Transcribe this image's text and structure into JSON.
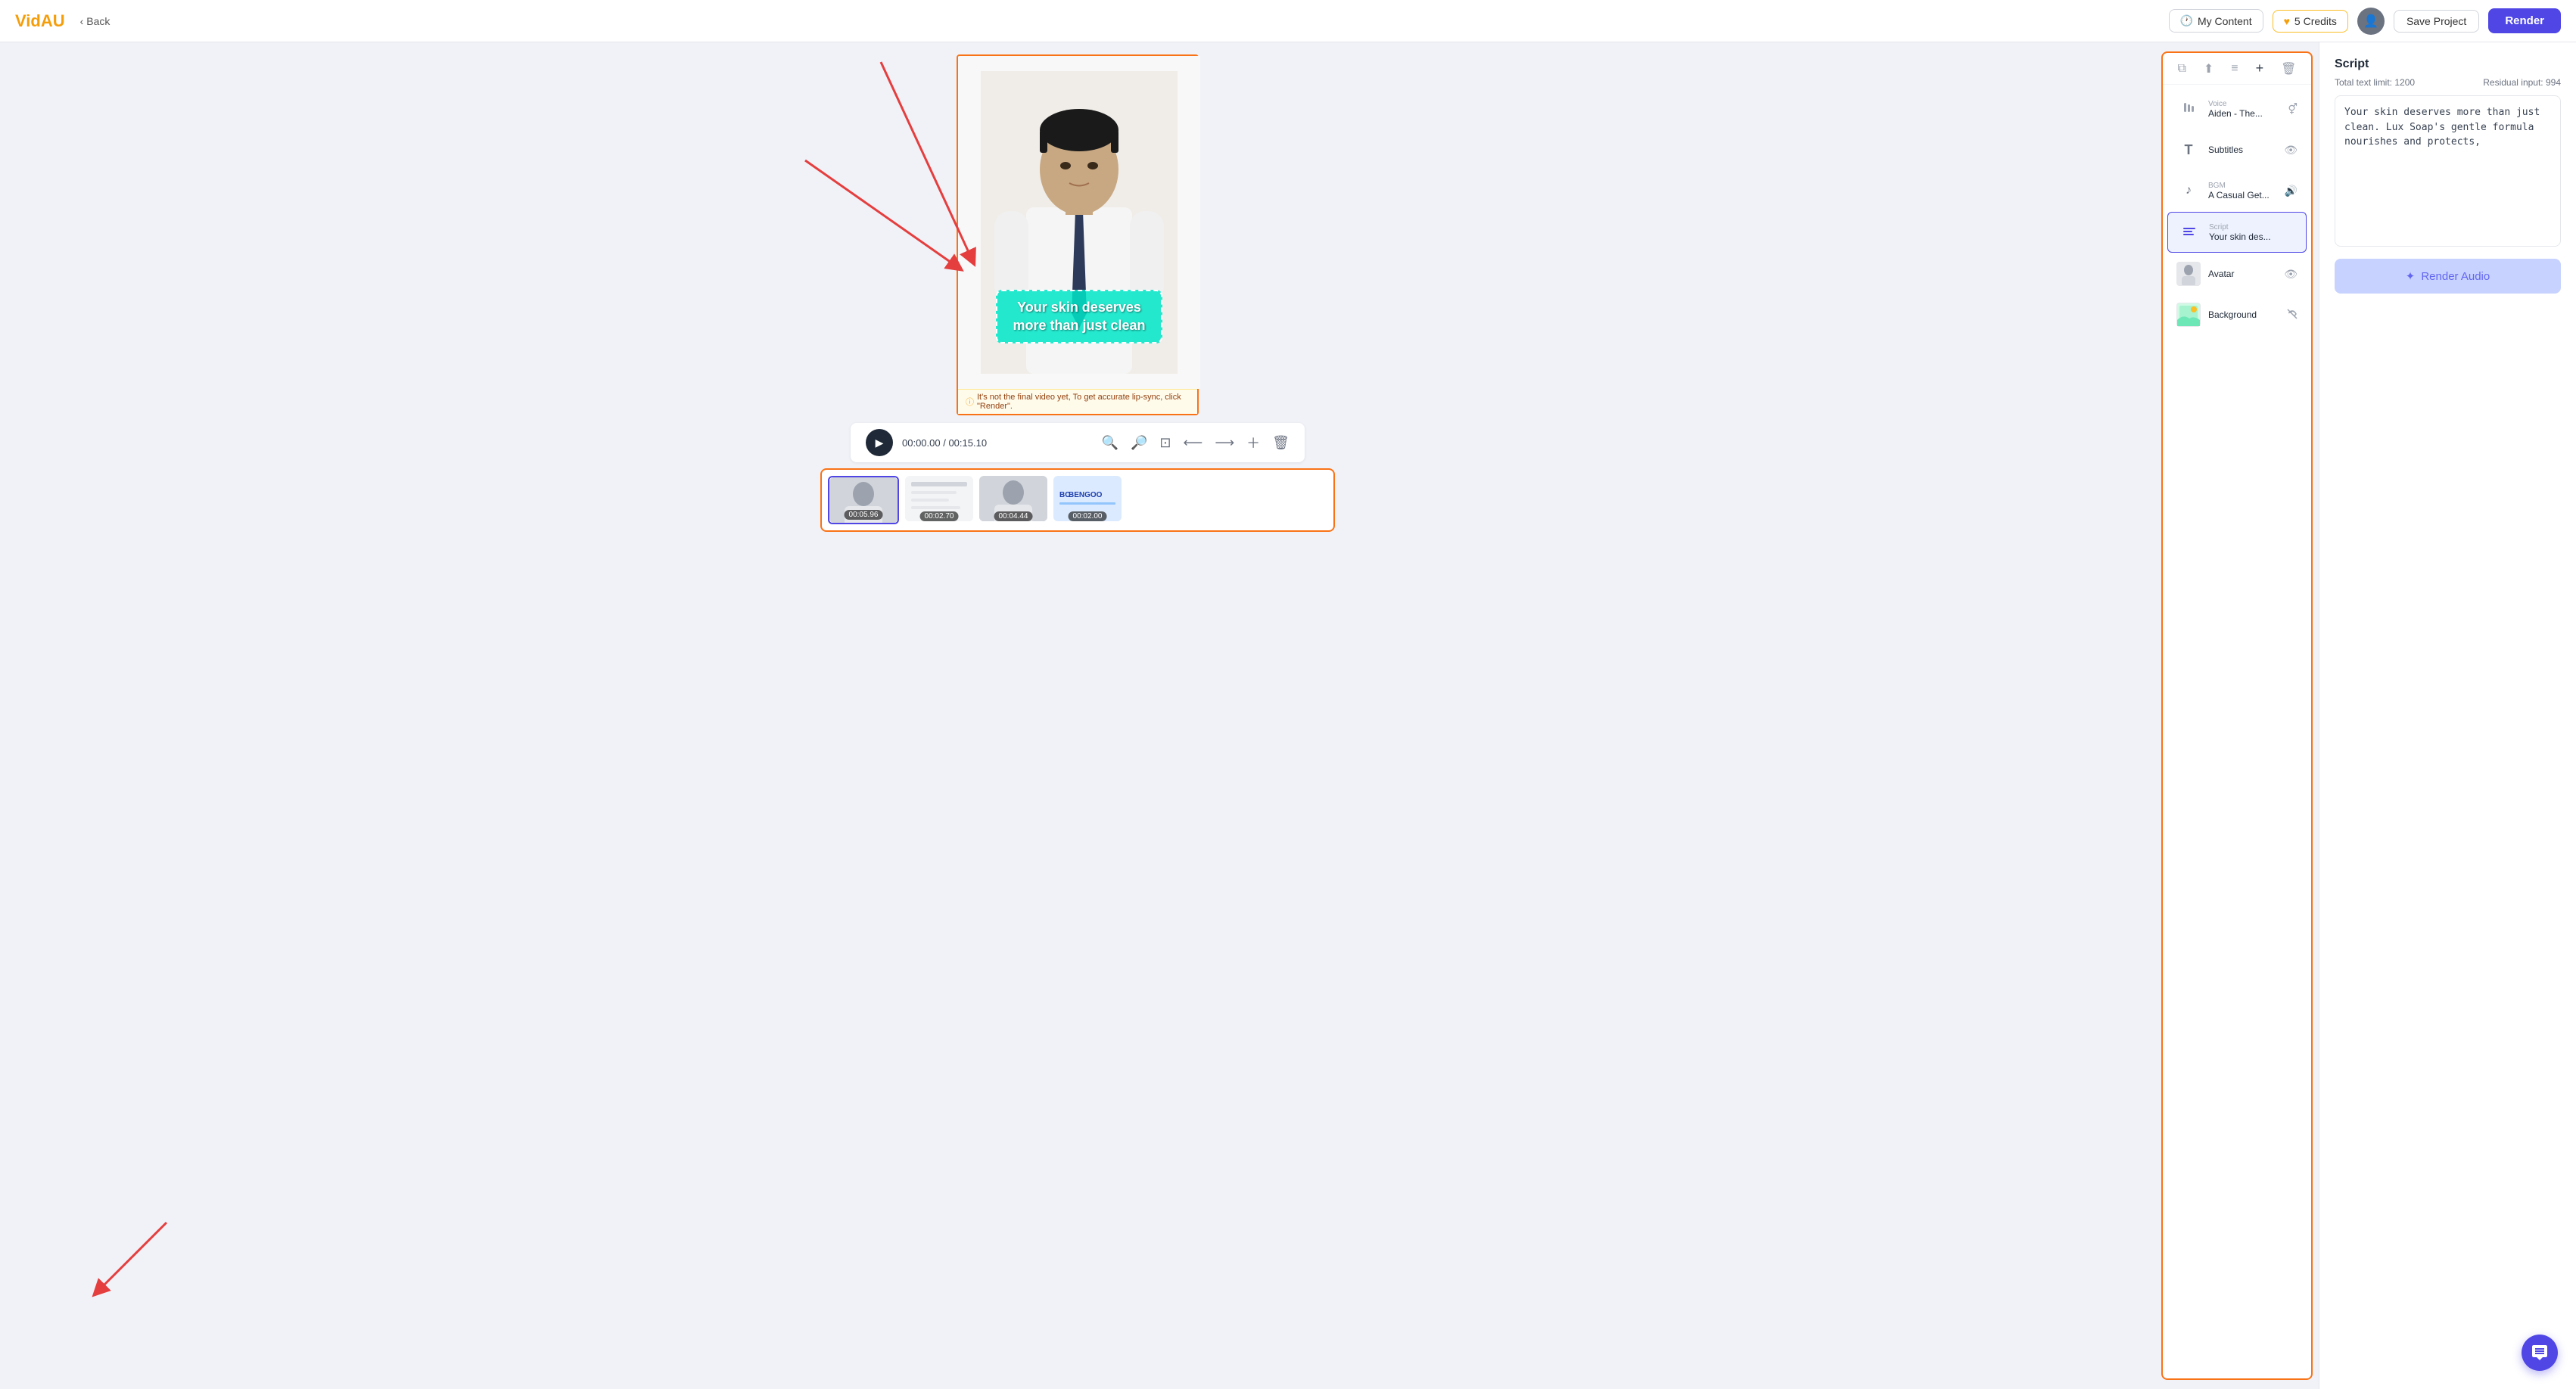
{
  "app": {
    "logo": "VidAU",
    "back_label": "Back"
  },
  "header": {
    "my_content_label": "My Content",
    "credits_label": "5 Credits",
    "save_project_label": "Save Project",
    "render_label": "Render"
  },
  "video": {
    "time_current": "00:00.00",
    "time_total": "00:15.10",
    "warning_text": "It's not the final video yet, To get accurate lip-sync, click \"Render\".",
    "subtitle_text": "Your skin deserves more than just clean"
  },
  "layers": {
    "items": [
      {
        "id": "voice",
        "type": "Voice",
        "name": "Aiden - The...",
        "icon": "🎤",
        "action": "gender"
      },
      {
        "id": "subtitles",
        "type": "",
        "name": "Subtitles",
        "icon": "T",
        "action": "eye"
      },
      {
        "id": "bgm",
        "type": "BGM",
        "name": "A Casual Get...",
        "icon": "🎵",
        "action": "volume"
      },
      {
        "id": "script",
        "type": "Script",
        "name": "Your skin des...",
        "icon": "≡",
        "action": "active"
      },
      {
        "id": "avatar",
        "type": "",
        "name": "Avatar",
        "icon": "avatar",
        "action": "eye"
      },
      {
        "id": "background",
        "type": "",
        "name": "Background",
        "icon": "bg",
        "action": "eye-off"
      }
    ]
  },
  "script": {
    "title": "Script",
    "total_limit_label": "Total text limit: 1200",
    "residual_label": "Residual input: 994",
    "content": "Your skin deserves more than just clean. Lux Soap's gentle formula nourishes and protects,",
    "render_audio_label": "Render Audio"
  },
  "timeline": {
    "clips": [
      {
        "id": 1,
        "duration": "00:05.96",
        "active": true
      },
      {
        "id": 2,
        "duration": "00:02.70",
        "active": false
      },
      {
        "id": 3,
        "duration": "00:04.44",
        "active": false
      },
      {
        "id": 4,
        "duration": "00:02.00",
        "active": false,
        "logo": "BENGOO"
      }
    ]
  },
  "colors": {
    "accent": "#4F46E5",
    "orange": "#f97316",
    "teal": "#0ee5c8"
  }
}
